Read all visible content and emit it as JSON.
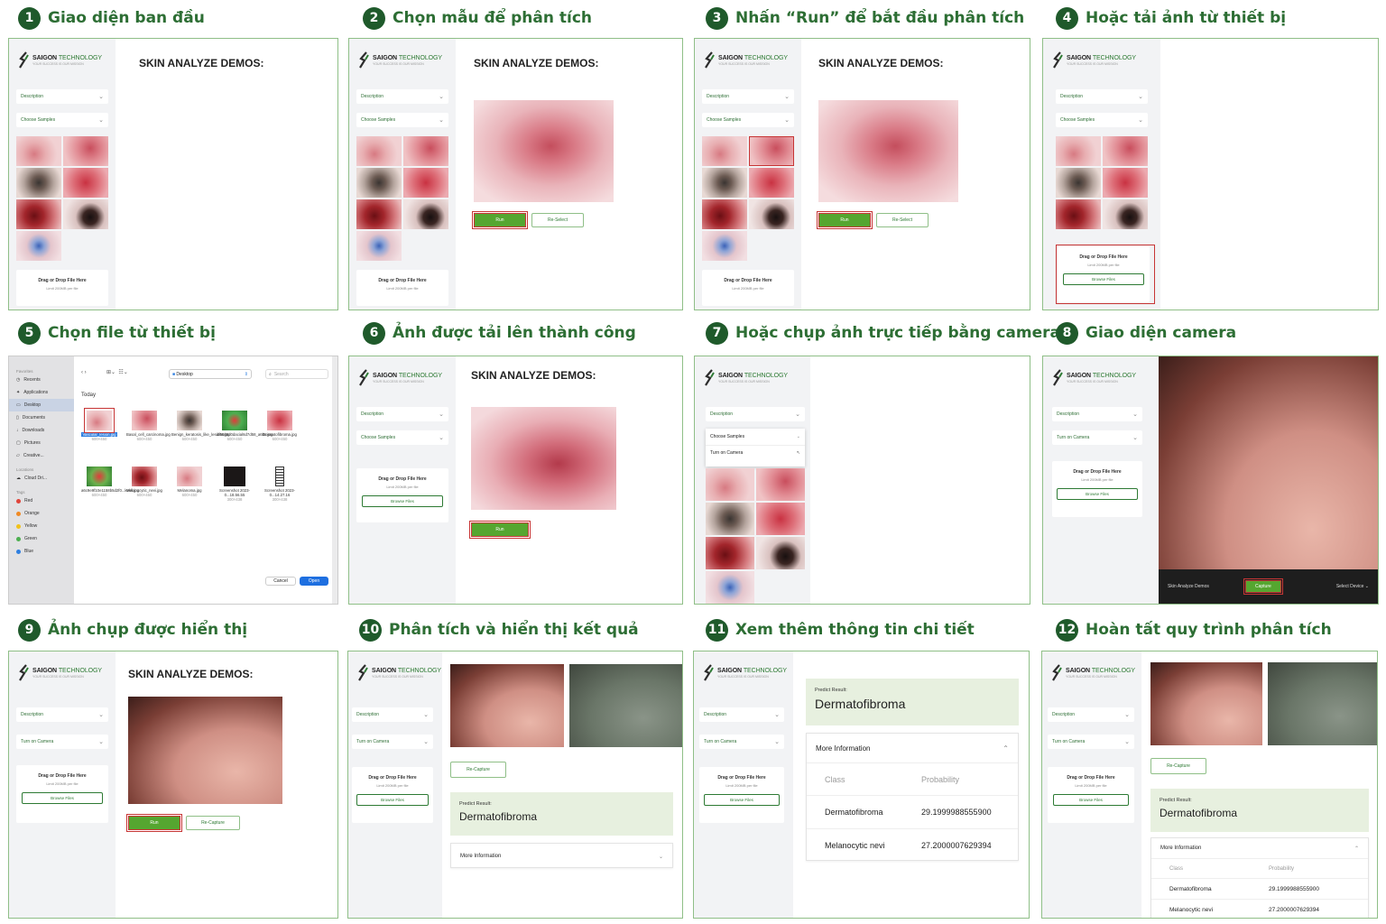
{
  "steps": [
    {
      "num": "1",
      "title": "Giao diện ban đầu"
    },
    {
      "num": "2",
      "title": "Chọn mẫu để phân tích"
    },
    {
      "num": "3",
      "title": "Nhấn “Run” để bắt đầu phân tích"
    },
    {
      "num": "4",
      "title": "Hoặc tải ảnh từ thiết bị"
    },
    {
      "num": "5",
      "title": "Chọn file từ thiết bị"
    },
    {
      "num": "6",
      "title": "Ảnh được tải lên thành công"
    },
    {
      "num": "7",
      "title": "Hoặc chụp ảnh trực tiếp bằng camera"
    },
    {
      "num": "8",
      "title": "Giao diện camera"
    },
    {
      "num": "9",
      "title": "Ảnh chụp được hiển thị"
    },
    {
      "num": "10",
      "title": "Phân tích và hiển thị kết quả"
    },
    {
      "num": "11",
      "title": "Xem thêm thông tin chi tiết"
    },
    {
      "num": "12",
      "title": "Hoàn tất quy trình phân tích"
    }
  ],
  "app": {
    "logo_brand": "SAIGON",
    "logo_tech": "TECHNOLOGY",
    "logo_tagline": "YOUR SUCCESS IS OUR MISSION",
    "page_title": "SKIN ANALYZE DEMOS:",
    "description": "Description",
    "choose_samples": "Choose Samples",
    "turn_on_camera": "Turn on Camera",
    "drop_title": "Drag or Drop File Here",
    "drop_limit": "Limit 200MB per file",
    "browse": "Browse Files",
    "run": "Run",
    "reselect": "Re-Select",
    "recapture": "Re-Capture",
    "capture": "Capture",
    "skin_demos": "Skin Analyze Demos",
    "select_device": "Select Device",
    "predict_label": "Predict Result:",
    "predict_value": "Dermatofibroma",
    "more_info": "More Information",
    "col_class": "Class",
    "col_prob": "Probability",
    "rows": [
      {
        "cls": "Dermatofibroma",
        "prob": "29.1999988555900"
      },
      {
        "cls": "Melanocytic nevi",
        "prob": "27.2000007629394"
      }
    ]
  },
  "dialog": {
    "favorites": "Favorites",
    "fav_items": [
      "Recents",
      "Applications",
      "Desktop",
      "Documents",
      "Downloads",
      "Pictures",
      "Creative..."
    ],
    "locations": "Locations",
    "loc_items": [
      "Cloud Dri..."
    ],
    "tags": "Tags",
    "tag_items": [
      {
        "name": "Red",
        "color": "#e0443a"
      },
      {
        "name": "Orange",
        "color": "#f08a24"
      },
      {
        "name": "Yellow",
        "color": "#f1c21b"
      },
      {
        "name": "Green",
        "color": "#4caf50"
      },
      {
        "name": "Blue",
        "color": "#2f7fe0"
      }
    ],
    "location": "Desktop",
    "search": "Search",
    "today": "Today",
    "files": [
      {
        "name": "Vascular_lesion.jpg",
        "size": "600×450"
      },
      {
        "name": "Basal_cell_carcinoma.jpg",
        "size": "600×450"
      },
      {
        "name": "Benign_keratosis_like_lesions.jpg",
        "size": "600×450"
      },
      {
        "name": "df5868d0dacial6d7d58_a6bc.jpg",
        "size": "600×450"
      },
      {
        "name": "Dermatofibroma.jpg",
        "size": "600×450"
      },
      {
        "name": "a6c9e9f10e1158b5d2f0...kekk.jpg",
        "size": "600×450"
      },
      {
        "name": "Melanocytic_nevi.jpg",
        "size": "600×450"
      },
      {
        "name": "Melanoma.jpg",
        "size": "600×450"
      },
      {
        "name": "Screenshot 2023-0...18.56.55",
        "size": "300×438"
      },
      {
        "name": "Screenshot 2023-0...14.27.16",
        "size": "300×438"
      }
    ],
    "cancel": "Cancel",
    "open": "Open"
  }
}
